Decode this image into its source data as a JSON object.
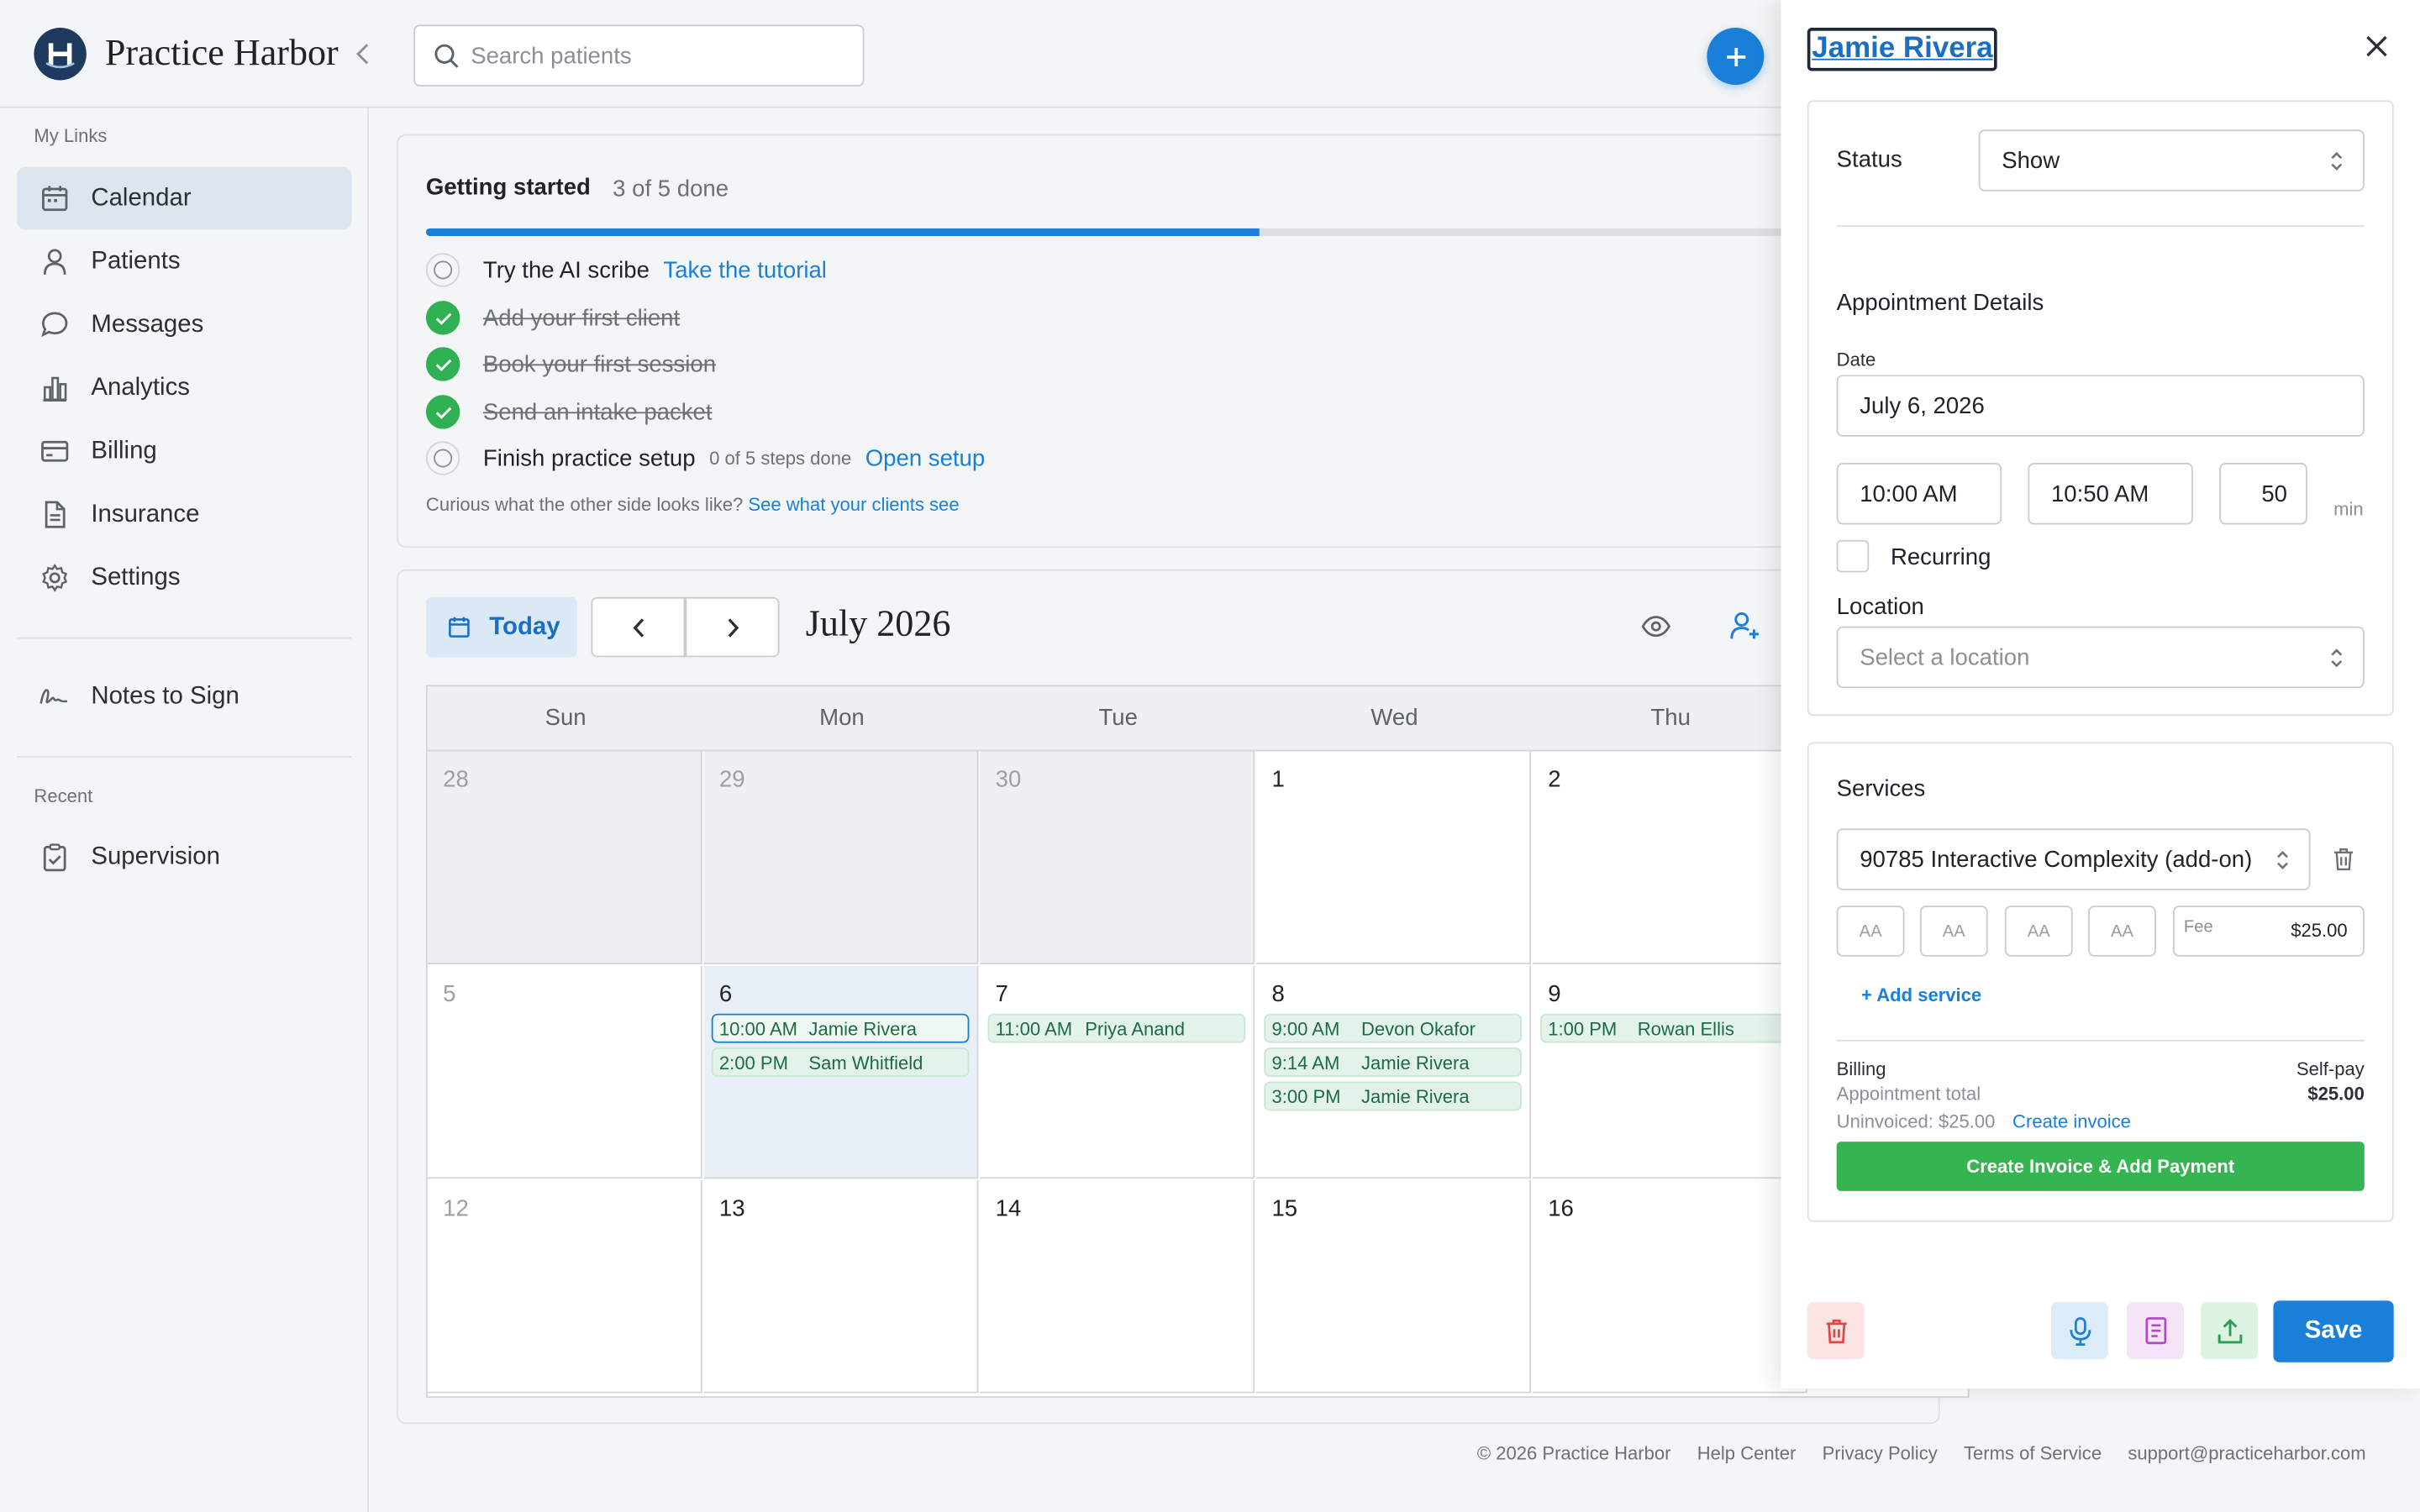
{
  "app": {
    "name": "Practice Harbor"
  },
  "search": {
    "placeholder": "Search patients"
  },
  "sidebar": {
    "section_links": "My Links",
    "items": [
      {
        "label": "Calendar",
        "icon": "calendar-icon",
        "active": true
      },
      {
        "label": "Patients",
        "icon": "person-icon"
      },
      {
        "label": "Messages",
        "icon": "chat-bubble-icon"
      },
      {
        "label": "Analytics",
        "icon": "bar-chart-icon"
      },
      {
        "label": "Billing",
        "icon": "credit-card-icon"
      },
      {
        "label": "Insurance",
        "icon": "document-icon"
      },
      {
        "label": "Settings",
        "icon": "gear-icon"
      }
    ],
    "notes_to_sign": "Notes to Sign",
    "section_recent": "Recent",
    "recent_items": [
      {
        "label": "Supervision",
        "icon": "clipboard-icon"
      }
    ]
  },
  "getting_started": {
    "title": "Getting started",
    "progress_text": "3 of 5 done",
    "progress_fraction": 0.6,
    "tasks": [
      {
        "label": "Try the AI scribe",
        "done": false,
        "link": "Take the tutorial"
      },
      {
        "label": "Add your first client",
        "done": true
      },
      {
        "label": "Book your first session",
        "done": true
      },
      {
        "label": "Send an intake packet",
        "done": true
      },
      {
        "label": "Finish practice setup",
        "done": false,
        "note": "0 of 5 steps done",
        "link": "Open setup"
      }
    ],
    "footer_text": "Curious what the other side looks like?",
    "footer_link": "See what your clients see"
  },
  "calendar": {
    "today_label": "Today",
    "month_title": "July 2026",
    "weekdays": [
      "Sun",
      "Mon",
      "Tue",
      "Wed",
      "Thu"
    ],
    "weeks": [
      [
        "28",
        "29",
        "30",
        "1",
        "2"
      ],
      [
        "5",
        "6",
        "7",
        "8",
        "9"
      ],
      [
        "12",
        "13",
        "14",
        "15",
        "16"
      ]
    ],
    "appointments": {
      "mon6": [
        {
          "time": "10:00 AM",
          "name": "Jamie Rivera"
        },
        {
          "time": "2:00 PM",
          "name": "Sam Whitfield"
        }
      ],
      "tue7": [
        {
          "time": "11:00 AM",
          "name": "Priya Anand"
        }
      ],
      "wed8": [
        {
          "time": "9:00 AM",
          "name": "Devon Okafor"
        },
        {
          "time": "9:14 AM",
          "name": "Jamie Rivera"
        },
        {
          "time": "3:00 PM",
          "name": "Jamie Rivera"
        }
      ],
      "thu9": [
        {
          "time": "1:00 PM",
          "name": "Rowan Ellis"
        }
      ]
    }
  },
  "footer": {
    "copyright": "© 2026 Practice Harbor",
    "links": [
      "Help Center",
      "Privacy Policy",
      "Terms of Service",
      "support@practiceharbor.com"
    ]
  },
  "drawer": {
    "title": "Jamie Rivera",
    "status_label": "Status",
    "status_value": "Show",
    "details_heading": "Appointment Details",
    "date_label": "Date",
    "date_value": "July 6, 2026",
    "start_time": "10:00 AM",
    "end_time": "10:50 AM",
    "duration": "50",
    "duration_unit": "min",
    "recurring_label": "Recurring",
    "location_label": "Location",
    "location_placeholder": "Select a location",
    "services_heading": "Services",
    "service_value": "90785 Interactive Complexity (add-on)",
    "modifiers": [
      "AA",
      "AA",
      "AA",
      "AA"
    ],
    "fee_label": "Fee",
    "fee_value": "$25.00",
    "add_service": "+ Add service",
    "billing_label": "Billing",
    "billing_type": "Self-pay",
    "appointment_total_label": "Appointment total",
    "appointment_total_value": "$25.00",
    "uninvoiced_text": "Uninvoiced: $25.00",
    "create_invoice_link": "Create invoice",
    "create_invoice_button": "Create Invoice & Add Payment",
    "save_label": "Save"
  },
  "colors": {
    "primary": "#1a7fd9",
    "success": "#34b552",
    "appointment_bg": "#e3f3ea"
  }
}
